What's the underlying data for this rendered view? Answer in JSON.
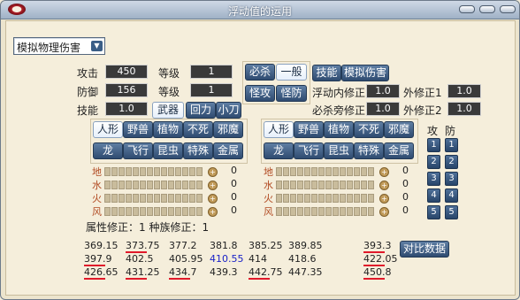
{
  "window": {
    "title": "浮动值的运用"
  },
  "dropdown": {
    "value": "模拟物理伤害"
  },
  "left": {
    "attack_label": "攻击",
    "attack_value": "450",
    "defense_label": "防御",
    "defense_value": "156",
    "skill_label": "技能",
    "skill_value": "1.0",
    "level_label": "等级",
    "level1_value": "1",
    "level2_value": "1"
  },
  "buttons": {
    "bisha": "必杀",
    "yiban": "一般",
    "guaigong": "怪攻",
    "guaifang": "怪防",
    "jineng": "技能",
    "moni": "模拟伤害",
    "wuqi": "武器",
    "huili": "回力",
    "xiaodao": "小刀",
    "compare": "对比数据"
  },
  "modifiers": {
    "fudong_label": "浮动内修正",
    "fudong_value": "1.0",
    "bisha_label": "必杀旁修正",
    "bisha_value": "1.0",
    "wai1_label": "外修正1",
    "wai1_value": "1.0",
    "wai2_label": "外修正2",
    "wai2_value": "1.0"
  },
  "races_row1": [
    "人形",
    "野兽",
    "植物",
    "不死",
    "邪魔"
  ],
  "races_row2": [
    "龙",
    "飞行",
    "昆虫",
    "特殊",
    "金属"
  ],
  "elements": [
    "地",
    "水",
    "火",
    "风"
  ],
  "element_zero": "0",
  "side": {
    "gong": "攻",
    "fang": "防",
    "numbers": [
      "1",
      "2",
      "3",
      "4",
      "5"
    ]
  },
  "footer": {
    "text": "属性修正：1 种族修正：1"
  },
  "results": [
    [
      "369.15",
      "373.75",
      "377.2",
      "381.8",
      "385.25",
      "389.85",
      "393.3"
    ],
    [
      "397.9",
      "402.5",
      "405.95",
      "410.55",
      "414",
      "418.6",
      "422.05"
    ],
    [
      "426.65",
      "431.25",
      "434.7",
      "439.3",
      "442.75",
      "447.35",
      "450.8"
    ]
  ],
  "colors": {
    "highlight_blue": "#1a22c8",
    "underline_red": "#e0192a"
  }
}
